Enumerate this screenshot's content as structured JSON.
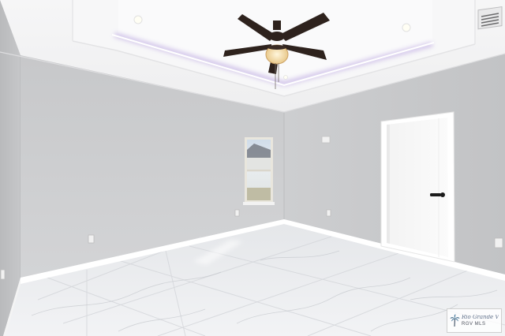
{
  "watermark": {
    "brand": "Rio Grande Valley",
    "subtitle": "RGV MLS",
    "icon": "palm-tree-icon"
  },
  "colors": {
    "wall": "#c9cacc",
    "ceiling": "#f3f3f4",
    "floor": "#eceef0",
    "trim": "#ffffff",
    "door": "#f7f7f7",
    "fan": "#2e221d",
    "cove_glow": "#c9b9e6",
    "handle": "#1c1c1c"
  }
}
